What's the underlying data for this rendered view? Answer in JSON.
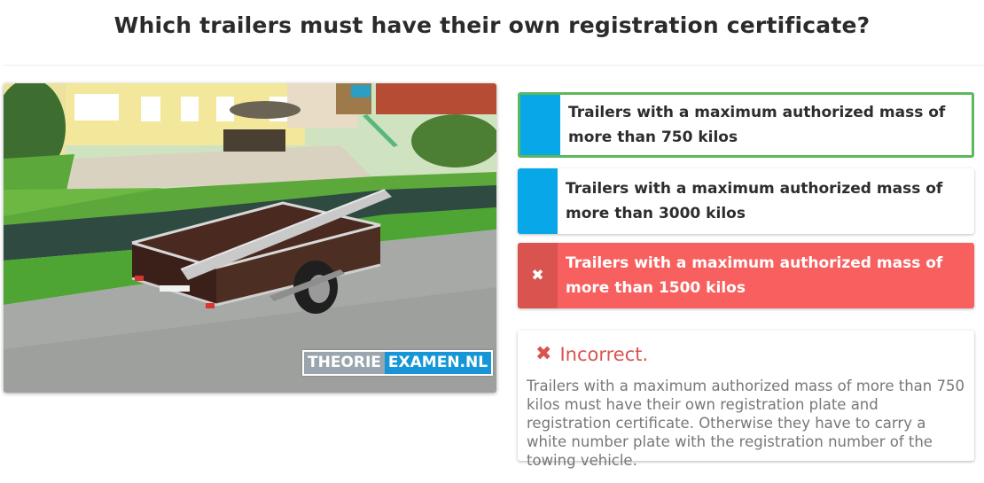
{
  "question": "Which trailers must have their own registration certificate?",
  "image": {
    "alt": "Trailer with ladder parked on street",
    "watermark_left": "THEORIE",
    "watermark_right": "EXAMEN.NL"
  },
  "options": [
    {
      "label": "Trailers with a maximum authorized mass of more than 750 kilos",
      "state": "correct"
    },
    {
      "label": "Trailers with a maximum authorized mass of more than 3000 kilos",
      "state": "neutral"
    },
    {
      "label": "Trailers with a maximum authorized mass of more than 1500 kilos",
      "state": "selected-wrong",
      "icon": "✖"
    }
  ],
  "feedback": {
    "icon": "✖",
    "status": "Incorrect.",
    "explanation": "Trailers with a maximum authorized mass of more than 750 kilos must have their own registration plate and registration certificate. Otherwise they have to carry a white number plate with the registration number of the towing vehicle."
  },
  "colors": {
    "correct_border": "#5cb85c",
    "option_marker": "#08a8e8",
    "wrong_bg": "#f7605f",
    "wrong_marker": "#d9534f"
  }
}
